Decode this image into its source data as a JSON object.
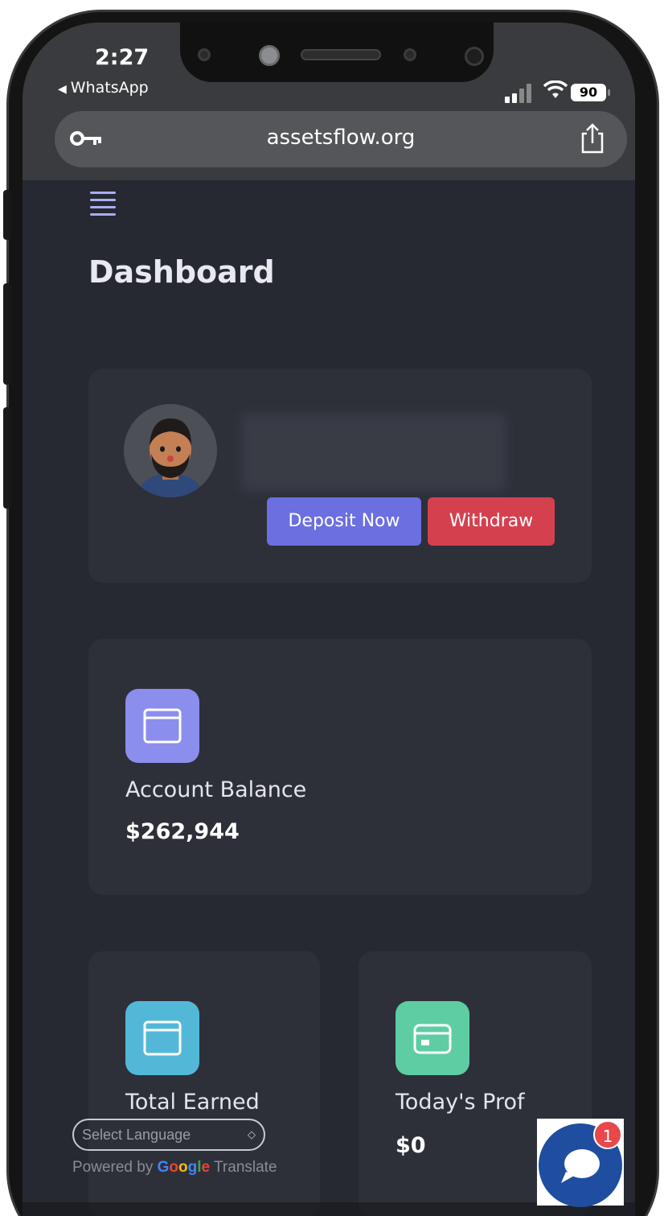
{
  "status_bar": {
    "time": "2:27",
    "back_app": "WhatsApp",
    "battery": "90"
  },
  "browser": {
    "url": "assetsflow.org",
    "icons": {
      "key": "key-icon",
      "share": "share-icon"
    }
  },
  "page": {
    "title": "Dashboard",
    "menu_icon": "hamburger-menu-icon"
  },
  "profile": {
    "avatar": "avatar",
    "deposit_label": "Deposit Now",
    "withdraw_label": "Withdraw"
  },
  "stats": {
    "account_balance": {
      "label": "Account Balance",
      "value": "$262,944",
      "icon": "wallet-icon",
      "color": "#8b8eed"
    },
    "total_earned": {
      "label": "Total Earned",
      "icon": "wallet-icon",
      "color": "#53b8d8"
    },
    "todays_profit": {
      "label": "Today's Prof",
      "value": "$0",
      "icon": "credit-card-icon",
      "color": "#5ecda3"
    }
  },
  "translate": {
    "select_placeholder": "Select Language",
    "powered_by": "Powered by",
    "google": [
      "G",
      "o",
      "o",
      "g",
      "l",
      "e"
    ],
    "translate": "Translate"
  },
  "chat": {
    "badge_count": "1",
    "icon": "chat-bubble-icon"
  },
  "colors": {
    "accent": "#6b6fe0",
    "danger": "#d5404f",
    "background": "#262832",
    "card": "#2d3039"
  }
}
